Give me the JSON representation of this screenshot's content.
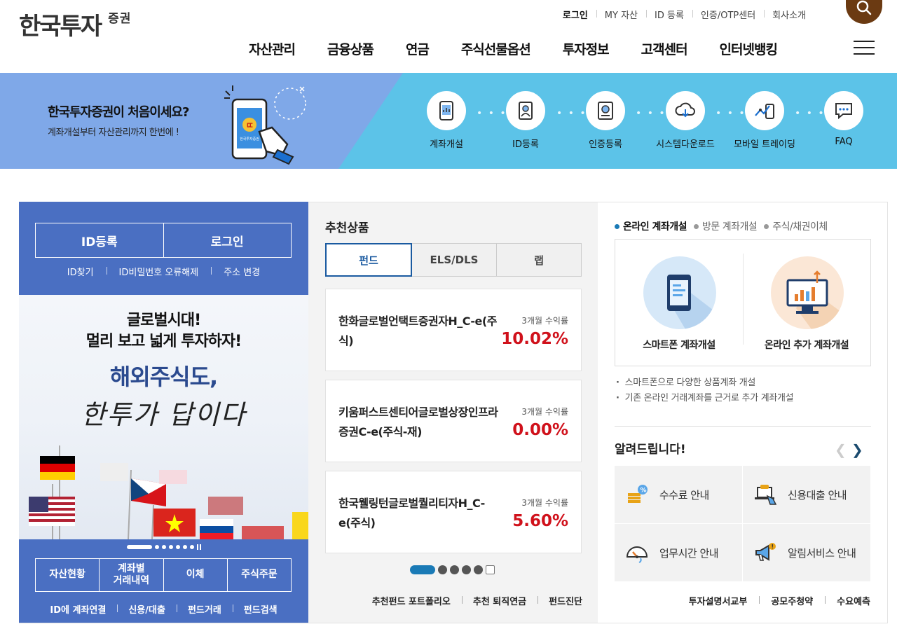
{
  "header": {
    "logo_main": "한국투자",
    "logo_sub": "증권",
    "util_links": [
      "로그인",
      "MY 자산",
      "ID 등록",
      "인증/OTP센터",
      "회사소개"
    ],
    "nav": [
      "자산관리",
      "금융상품",
      "연금",
      "주식선물옵션",
      "투자정보",
      "고객센터",
      "인터넷뱅킹"
    ]
  },
  "band": {
    "title": "한국투자증권이 처음이세요?",
    "subtitle": "계좌개설부터 자산관리까지 한번에 !",
    "phone_text": "한국투자증권",
    "quick_menu": [
      "계좌개설",
      "ID등록",
      "인증등록",
      "시스템다운로드",
      "모바일 트레이딩",
      "FAQ"
    ]
  },
  "left_panel": {
    "login_buttons": [
      "ID등록",
      "로그인"
    ],
    "login_links": [
      "ID찾기",
      "ID비밀번호 오류해제",
      "주소 변경"
    ],
    "promo": {
      "line1": "글로벌시대!",
      "line2": "멀리 보고 넓게 투자하자!",
      "line3": "해외주식도,",
      "line4": "한투가 답이다"
    },
    "services": [
      "자산현황",
      "계좌별\n거래내역",
      "이체",
      "주식주문"
    ],
    "service_links": [
      "ID에 계좌연결",
      "신용/대출",
      "펀드거래",
      "펀드검색"
    ]
  },
  "mid_panel": {
    "title": "추천상품",
    "tabs": [
      "펀드",
      "ELS/DLS",
      "랩"
    ],
    "products": [
      {
        "name": "한화글로벌언택트증권자H_C-e(주식)",
        "return_label": "3개월 수익률",
        "return_value": "10.02%"
      },
      {
        "name": "키움퍼스트센티어글로벌상장인프라증권C-e(주식-재)",
        "return_label": "3개월 수익률",
        "return_value": "0.00%"
      },
      {
        "name": "한국웰링턴글로벌퀄리티자H_C-e(주식)",
        "return_label": "3개월 수익률",
        "return_value": "5.60%"
      }
    ],
    "links": [
      "추천펀드 포트폴리오",
      "추천 퇴직연금",
      "펀드진단"
    ]
  },
  "right_panel": {
    "account_tabs": [
      "온라인 계좌개설",
      "방문 계좌개설",
      "주식/채권이체"
    ],
    "account_options": [
      "스마트폰 계좌개설",
      "온라인 추가 계좌개설"
    ],
    "notes": [
      "스마트폰으로 다양한 상품계좌 개설",
      "기존 온라인 거래계좌를 근거로 추가 계좌개설"
    ],
    "notice_title": "알려드립니다!",
    "notices": [
      "수수료 안내",
      "신용대출 안내",
      "업무시간 안내",
      "알림서비스 안내"
    ],
    "links": [
      "투자설명서교부",
      "공모주청약",
      "수요예측"
    ]
  },
  "colors": {
    "band_left": "#7fa8e8",
    "band_right": "#5cc3e8",
    "left_panel": "#4a6fc2",
    "accent_blue": "#1a5aa0",
    "return_red": "#d0111b",
    "search_button": "#6b3a12"
  }
}
